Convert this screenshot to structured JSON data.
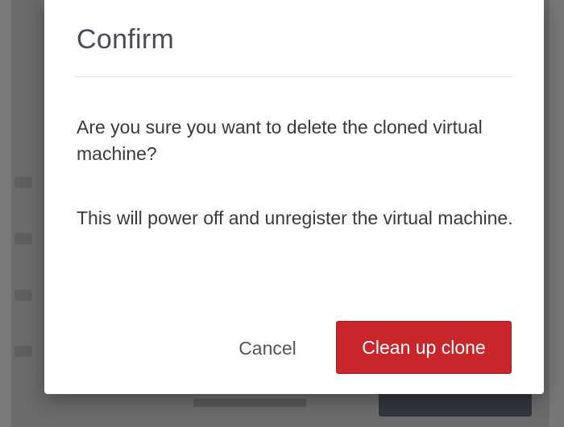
{
  "dialog": {
    "title": "Confirm",
    "message_primary": "Are you sure you want to delete the cloned virtual machine?",
    "message_secondary": "This will power off and unregister the virtual machine.",
    "cancel_label": "Cancel",
    "confirm_label": "Clean up clone"
  },
  "colors": {
    "primary_button": "#c9262c",
    "overlay": "#6b6b6b",
    "title_text": "#4b4b5c"
  }
}
